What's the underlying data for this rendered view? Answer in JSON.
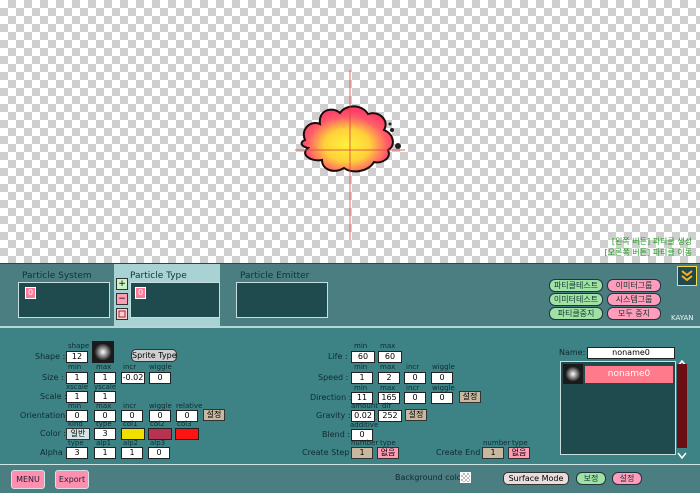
{
  "hint": {
    "line1": "[왼쪽 버튼] 파티클 생성",
    "line2": "[오른쪽 버튼] 파티클 이동"
  },
  "panel": {
    "system_title": "Particle System",
    "type_title": "Particle Type",
    "emitter_title": "Particle Emitter",
    "system_item": "0",
    "type_item": "0",
    "add_symbol": "+",
    "remove_symbol": "−",
    "buttons": [
      "파티클테스트",
      "이미터그룹",
      "이미터테스트",
      "시스템그룹",
      "파티클중지",
      "모두 중지"
    ],
    "kayan": "KAYAN"
  },
  "shape": {
    "label": "Shape :",
    "head": "shape",
    "value": "12",
    "button": "Sprite Type"
  },
  "size": {
    "label": "Size :",
    "heads": [
      "min",
      "max",
      "incr",
      "wiggle"
    ],
    "values": [
      "1",
      "1",
      "-0.02",
      "0"
    ]
  },
  "scale": {
    "label": "Scale :",
    "heads": [
      "xscale",
      "yscale"
    ],
    "values": [
      "1",
      "1"
    ]
  },
  "orientation": {
    "label": "Orientation :",
    "heads": [
      "min",
      "max",
      "incr",
      "wiggle",
      "relative"
    ],
    "values": [
      "0",
      "0",
      "0",
      "0",
      "0"
    ],
    "set": "설정"
  },
  "color": {
    "label": "Color :",
    "heads": [
      "kind",
      "type",
      "col1",
      "col2",
      "col3"
    ],
    "kind": "일반",
    "type": "3",
    "col1": "#f0e000",
    "col2": "#b8334f",
    "col3": "#ff1414"
  },
  "alpha": {
    "label": "Alpha :",
    "heads": [
      "type",
      "alp1",
      "alp2",
      "alp3"
    ],
    "values": [
      "3",
      "1",
      "1",
      "0"
    ]
  },
  "life": {
    "label": "Life :",
    "heads": [
      "min",
      "max"
    ],
    "values": [
      "60",
      "60"
    ]
  },
  "speed": {
    "label": "Speed :",
    "heads": [
      "min",
      "max",
      "incr",
      "wiggle"
    ],
    "values": [
      "1",
      "2",
      "0",
      "0"
    ]
  },
  "direction": {
    "label": "Direction :",
    "heads": [
      "min",
      "max",
      "incr",
      "wiggle"
    ],
    "values": [
      "11",
      "165",
      "0",
      "0"
    ],
    "set": "설정"
  },
  "gravity": {
    "label": "Gravity :",
    "heads": [
      "amount",
      "dir"
    ],
    "values": [
      "0.02",
      "252"
    ],
    "set": "설정"
  },
  "blend": {
    "label": "Blend :",
    "head": "additive",
    "value": "0"
  },
  "create_step": {
    "label": "Create Step :",
    "heads": [
      "number",
      "type"
    ],
    "number": "1",
    "type": "없음"
  },
  "create_end": {
    "label": "Create End :",
    "heads": [
      "number",
      "type"
    ],
    "number": "1",
    "type": "없음"
  },
  "name": {
    "label": "Name:",
    "value": "noname0",
    "list_item": "noname0"
  },
  "bottom": {
    "menu": "MENU",
    "export": "Export",
    "bg_label": "Background color :",
    "surface": "Surface Mode",
    "save": "보정",
    "settings": "설정"
  }
}
